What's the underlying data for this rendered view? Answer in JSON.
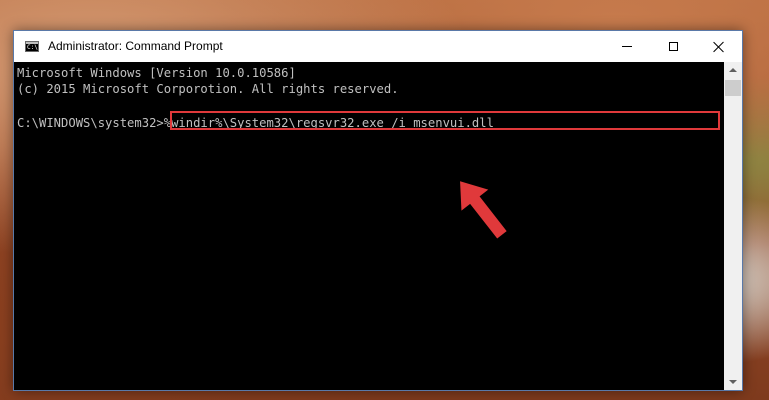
{
  "window": {
    "title": "Administrator: Command Prompt"
  },
  "console": {
    "lines": [
      "Microsoft Windows [Version 10.0.10586]",
      "(c) 2015 Microsoft Corporotion. All rights reserved.",
      "C:\\WINDOWS\\system32>%windir%\\System32\\regsvr32.exe /i msenvui.dll"
    ]
  },
  "colors": {
    "highlight": "#e0393b",
    "console_text": "#c0c0c0",
    "console_bg": "#000000"
  },
  "icons": {
    "app": "command-prompt-icon",
    "minimize": "minimize-icon",
    "maximize": "maximize-icon",
    "close": "close-icon",
    "annotation": "red-arrow-icon"
  }
}
